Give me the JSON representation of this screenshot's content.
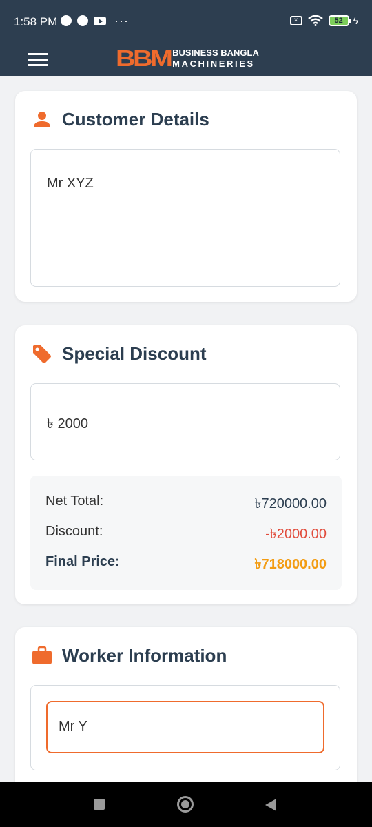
{
  "status_bar": {
    "time": "1:58 PM",
    "battery": "52"
  },
  "app_bar": {
    "logo_mark": "BBM",
    "logo_line1": "BUSINESS BANGLA",
    "logo_line2": "MACHINERIES"
  },
  "customer": {
    "title": "Customer Details",
    "icon": "person-icon",
    "value": "Mr XYZ"
  },
  "discount": {
    "title": "Special Discount",
    "icon": "tag-icon",
    "value": "৳ 2000",
    "net_total_label": "Net Total:",
    "net_total_value": "৳720000.00",
    "discount_label": "Discount:",
    "discount_value": "-৳2000.00",
    "final_label": "Final Price:",
    "final_value": "৳718000.00"
  },
  "worker": {
    "title": "Worker Information",
    "icon": "briefcase-icon",
    "value": "Mr Y"
  },
  "colors": {
    "header_bg": "#2d3e50",
    "accent": "#ef6b2d",
    "discount_red": "#e14c3c",
    "final_orange": "#f39c12"
  }
}
